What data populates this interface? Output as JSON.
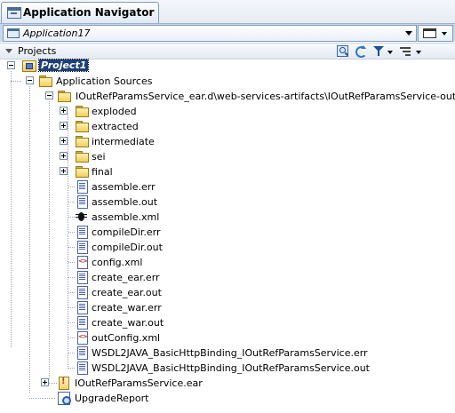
{
  "window": {
    "title": "Application Navigator"
  },
  "application": {
    "name": "Application17"
  },
  "projects": {
    "label": "Projects",
    "toolbar": [
      "search-icon",
      "sync-icon",
      "filter-icon",
      "sort-icon"
    ]
  },
  "tree": {
    "project": "Project1",
    "sources": "Application Sources",
    "output_dir": "IOutRefParamsService_ear.d\\web-services-artifacts\\IOutRefParamsService-output",
    "folders": [
      "exploded",
      "extracted",
      "intermediate",
      "sei",
      "final"
    ],
    "files": [
      "assemble.err",
      "assemble.out",
      "assemble.xml",
      "compileDir.err",
      "compileDir.out",
      "config.xml",
      "create_ear.err",
      "create_ear.out",
      "create_war.err",
      "create_war.out",
      "outConfig.xml",
      "WSDL2JAVA_BasicHttpBinding_IOutRefParamsService.err",
      "WSDL2JAVA_BasicHttpBinding_IOutRefParamsService.out"
    ],
    "ear_file": "IOutRefParamsService.ear",
    "report": "UpgradeReport"
  }
}
